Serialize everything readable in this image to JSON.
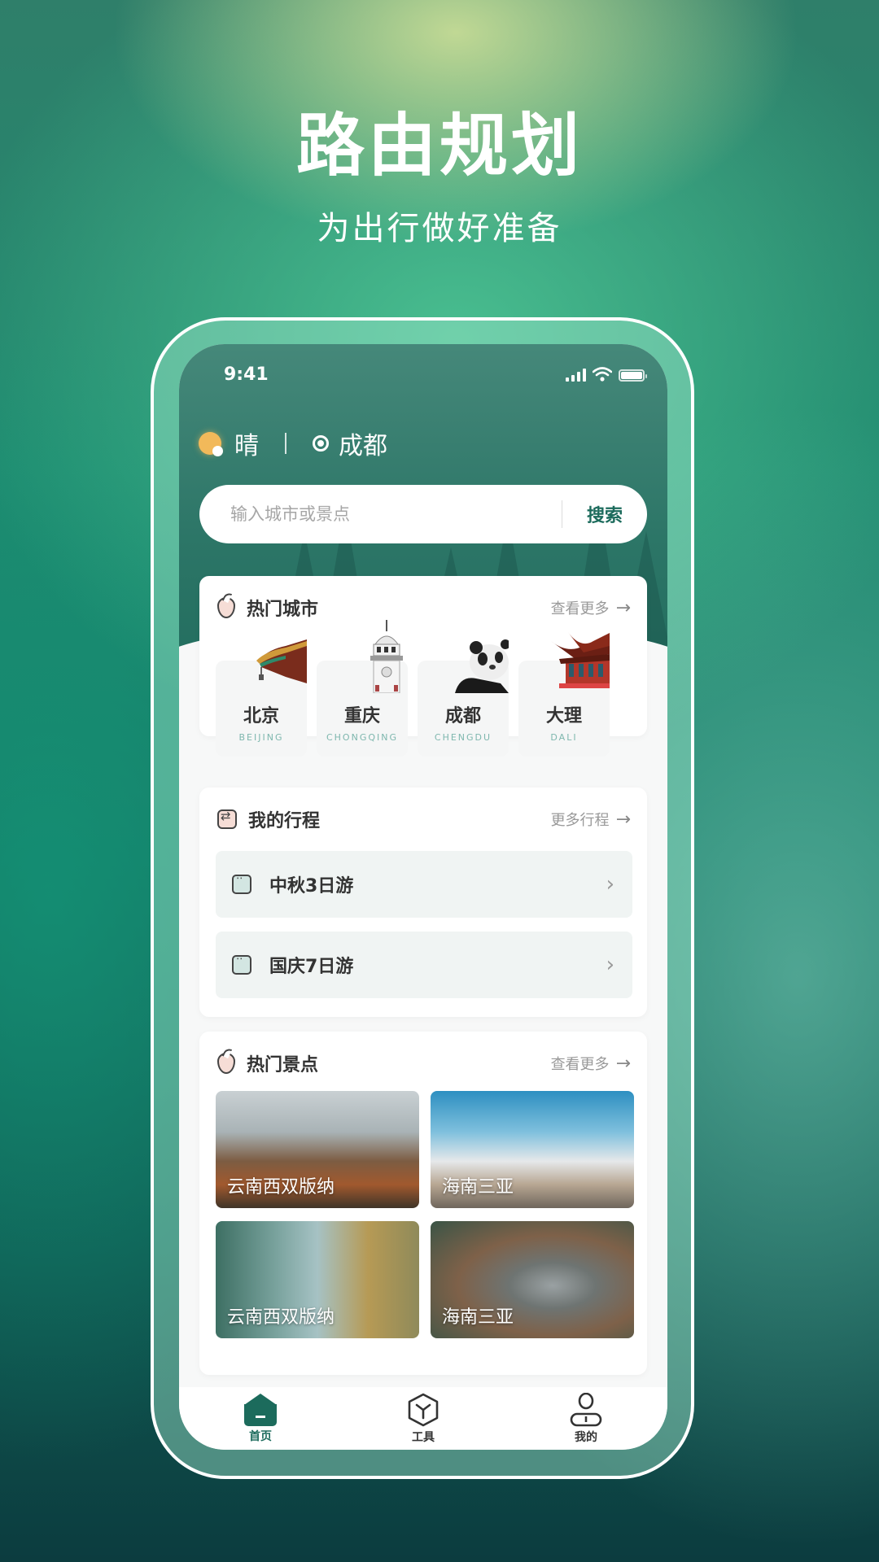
{
  "hero": {
    "title": "路由规划",
    "subtitle": "为出行做好准备"
  },
  "status_bar": {
    "time": "9:41",
    "icons": [
      "signal-icon",
      "wifi-icon",
      "battery-icon"
    ]
  },
  "weather": {
    "icon": "sun-icon",
    "condition": "晴",
    "location_icon": "location-target-icon",
    "city": "成都"
  },
  "search": {
    "placeholder": "输入城市或景点",
    "value": "",
    "button_label": "搜索"
  },
  "hot_cities": {
    "icon": "flame-icon",
    "title": "热门城市",
    "more_label": "查看更多",
    "items": [
      {
        "name": "北京",
        "pinyin": "BEIJING"
      },
      {
        "name": "重庆",
        "pinyin": "CHONGQING"
      },
      {
        "name": "成都",
        "pinyin": "CHENGDU"
      },
      {
        "name": "大理",
        "pinyin": "DALI"
      }
    ]
  },
  "my_trips": {
    "icon": "route-icon",
    "title": "我的行程",
    "more_label": "更多行程",
    "items": [
      {
        "label": "中秋3日游"
      },
      {
        "label": "国庆7日游"
      }
    ]
  },
  "hot_spots": {
    "icon": "flame-icon",
    "title": "热门景点",
    "more_label": "查看更多",
    "items": [
      {
        "label": "云南西双版纳"
      },
      {
        "label": "海南三亚"
      },
      {
        "label": "云南西双版纳"
      },
      {
        "label": "海南三亚"
      }
    ]
  },
  "bottom_nav": {
    "items": [
      {
        "label": "首页",
        "icon": "home-icon",
        "active": true
      },
      {
        "label": "工具",
        "icon": "tools-cube-icon",
        "active": false
      },
      {
        "label": "我的",
        "icon": "profile-icon",
        "active": false
      }
    ]
  },
  "colors": {
    "accent": "#1c6b5c",
    "header_bg": "#2d7a68",
    "pinyin": "#7eb7ae",
    "sun": "#f2b95a"
  }
}
